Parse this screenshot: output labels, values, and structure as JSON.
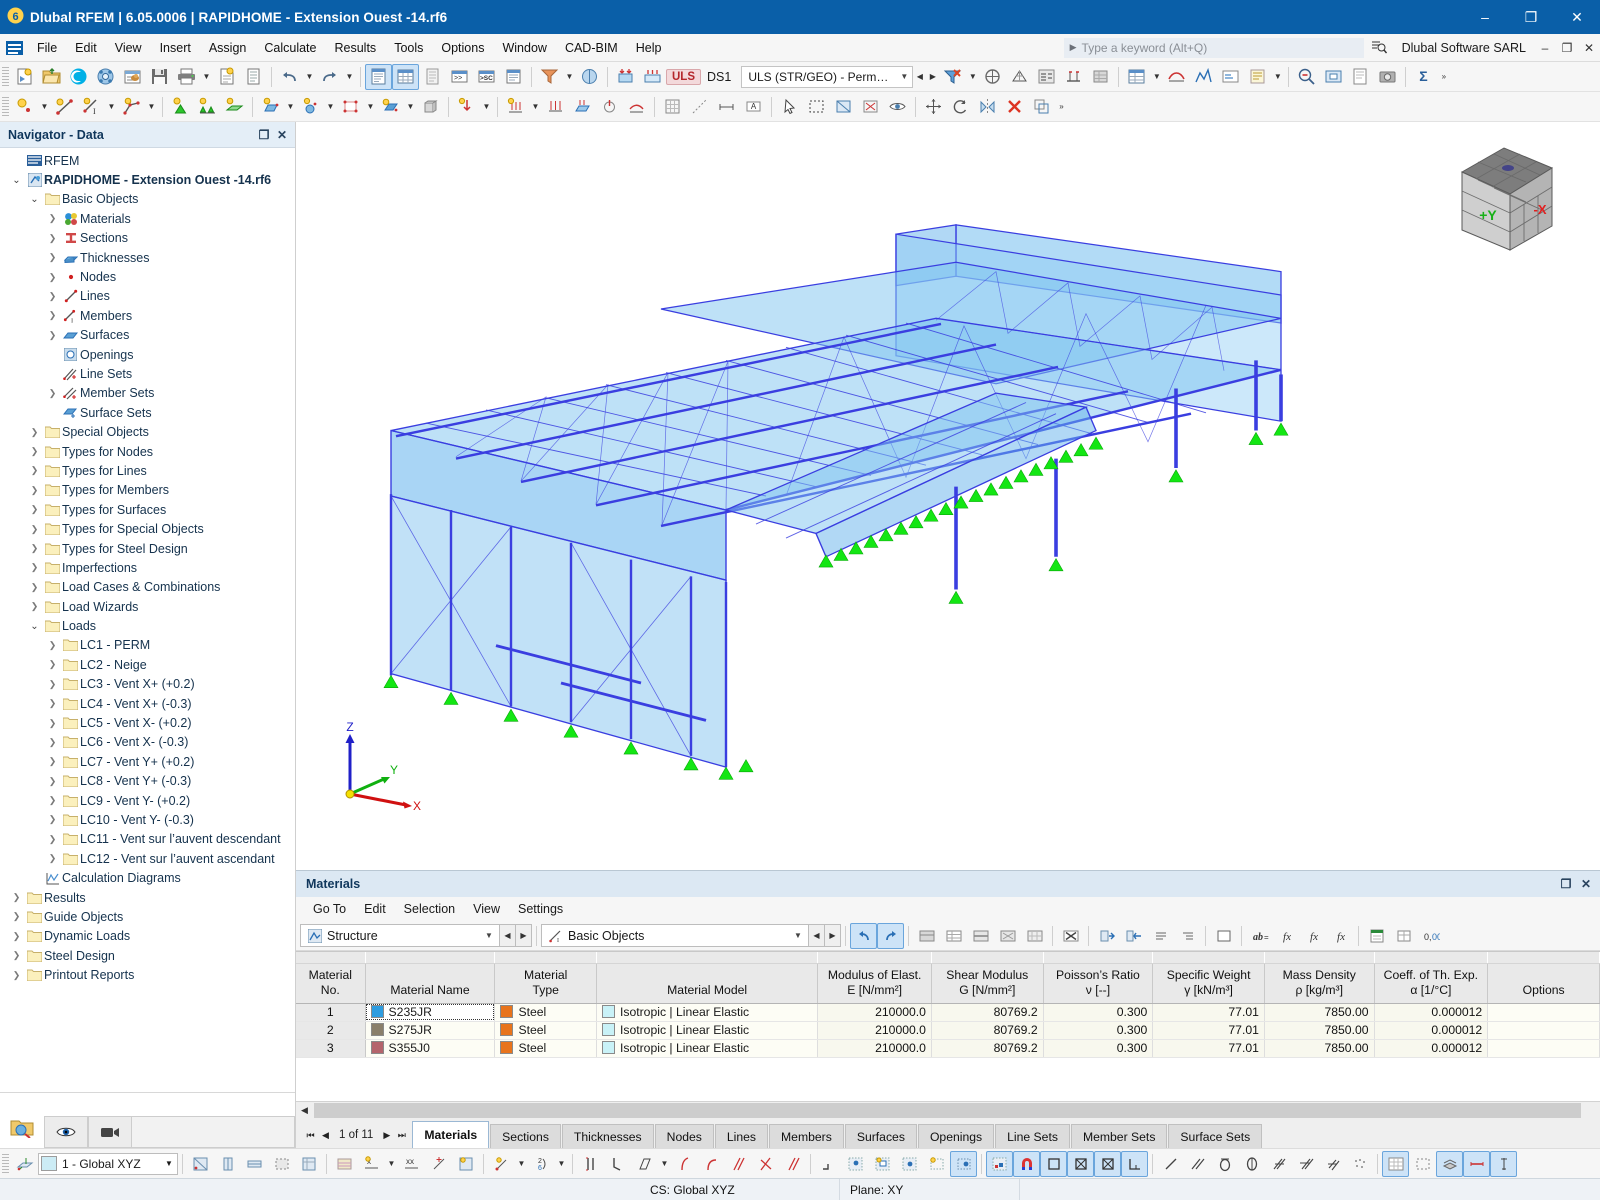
{
  "titlebar": {
    "icon": "dlubal-logo-icon",
    "text": "Dlubal RFEM | 6.05.0006 | RAPIDHOME - Extension Ouest -14.rf6",
    "minimize": "–",
    "maximize": "❐",
    "close": "✕"
  },
  "menubar": {
    "items": [
      "File",
      "Edit",
      "View",
      "Insert",
      "Assign",
      "Calculate",
      "Results",
      "Tools",
      "Options",
      "Window",
      "CAD-BIM",
      "Help"
    ],
    "search_placeholder": "Type a keyword (Alt+Q)",
    "company": "Dlubal Software SARL",
    "win_minimize": "–",
    "win_restore": "❐",
    "win_close": "✕"
  },
  "toolbar": {
    "uls_badge": "ULS",
    "design_situation": "DS1",
    "combination": "ULS (STR/GEO) - Permane...",
    "combination_full": "ULS (STR/GEO) - Permanent / transient"
  },
  "navigator": {
    "title": "Navigator - Data",
    "undock": "❐",
    "close": "✕",
    "tree": [
      {
        "depth": 0,
        "label": "RFEM",
        "icon": "rfem-icon",
        "twisty": "none",
        "bold": false
      },
      {
        "depth": 0,
        "label": "RAPIDHOME - Extension Ouest -14.rf6",
        "icon": "model-icon",
        "twisty": "open",
        "bold": true
      },
      {
        "depth": 1,
        "label": "Basic Objects",
        "icon": "folder-icon",
        "twisty": "open",
        "bold": false
      },
      {
        "depth": 2,
        "label": "Materials",
        "icon": "materials-icon",
        "twisty": "closed",
        "bold": false
      },
      {
        "depth": 2,
        "label": "Sections",
        "icon": "sections-icon",
        "twisty": "closed",
        "bold": false
      },
      {
        "depth": 2,
        "label": "Thicknesses",
        "icon": "thicknesses-icon",
        "twisty": "closed",
        "bold": false
      },
      {
        "depth": 2,
        "label": "Nodes",
        "icon": "node-icon",
        "twisty": "closed",
        "bold": false
      },
      {
        "depth": 2,
        "label": "Lines",
        "icon": "line-icon",
        "twisty": "closed",
        "bold": false
      },
      {
        "depth": 2,
        "label": "Members",
        "icon": "member-icon",
        "twisty": "closed",
        "bold": false
      },
      {
        "depth": 2,
        "label": "Surfaces",
        "icon": "surface-icon",
        "twisty": "closed",
        "bold": false
      },
      {
        "depth": 2,
        "label": "Openings",
        "icon": "opening-icon",
        "twisty": "none",
        "bold": false
      },
      {
        "depth": 2,
        "label": "Line Sets",
        "icon": "line-set-icon",
        "twisty": "none",
        "bold": false
      },
      {
        "depth": 2,
        "label": "Member Sets",
        "icon": "member-set-icon",
        "twisty": "closed",
        "bold": false
      },
      {
        "depth": 2,
        "label": "Surface Sets",
        "icon": "surface-set-icon",
        "twisty": "none",
        "bold": false
      },
      {
        "depth": 1,
        "label": "Special Objects",
        "icon": "folder-icon",
        "twisty": "closed",
        "bold": false
      },
      {
        "depth": 1,
        "label": "Types for Nodes",
        "icon": "folder-icon",
        "twisty": "closed",
        "bold": false
      },
      {
        "depth": 1,
        "label": "Types for Lines",
        "icon": "folder-icon",
        "twisty": "closed",
        "bold": false
      },
      {
        "depth": 1,
        "label": "Types for Members",
        "icon": "folder-icon",
        "twisty": "closed",
        "bold": false
      },
      {
        "depth": 1,
        "label": "Types for Surfaces",
        "icon": "folder-icon",
        "twisty": "closed",
        "bold": false
      },
      {
        "depth": 1,
        "label": "Types for Special Objects",
        "icon": "folder-icon",
        "twisty": "closed",
        "bold": false
      },
      {
        "depth": 1,
        "label": "Types for Steel Design",
        "icon": "folder-icon",
        "twisty": "closed",
        "bold": false
      },
      {
        "depth": 1,
        "label": "Imperfections",
        "icon": "folder-icon",
        "twisty": "closed",
        "bold": false
      },
      {
        "depth": 1,
        "label": "Load Cases & Combinations",
        "icon": "folder-icon",
        "twisty": "closed",
        "bold": false
      },
      {
        "depth": 1,
        "label": "Load Wizards",
        "icon": "folder-icon",
        "twisty": "closed",
        "bold": false
      },
      {
        "depth": 1,
        "label": "Loads",
        "icon": "folder-icon",
        "twisty": "open",
        "bold": false
      },
      {
        "depth": 2,
        "label": "LC1 - PERM",
        "icon": "folder-icon",
        "twisty": "closed",
        "bold": false
      },
      {
        "depth": 2,
        "label": "LC2 - Neige",
        "icon": "folder-icon",
        "twisty": "closed",
        "bold": false
      },
      {
        "depth": 2,
        "label": "LC3 - Vent X+ (+0.2)",
        "icon": "folder-icon",
        "twisty": "closed",
        "bold": false
      },
      {
        "depth": 2,
        "label": "LC4 - Vent X+ (-0.3)",
        "icon": "folder-icon",
        "twisty": "closed",
        "bold": false
      },
      {
        "depth": 2,
        "label": "LC5 - Vent X- (+0.2)",
        "icon": "folder-icon",
        "twisty": "closed",
        "bold": false
      },
      {
        "depth": 2,
        "label": "LC6 - Vent X- (-0.3)",
        "icon": "folder-icon",
        "twisty": "closed",
        "bold": false
      },
      {
        "depth": 2,
        "label": "LC7 - Vent Y+ (+0.2)",
        "icon": "folder-icon",
        "twisty": "closed",
        "bold": false
      },
      {
        "depth": 2,
        "label": "LC8 - Vent Y+ (-0.3)",
        "icon": "folder-icon",
        "twisty": "closed",
        "bold": false
      },
      {
        "depth": 2,
        "label": "LC9 - Vent Y- (+0.2)",
        "icon": "folder-icon",
        "twisty": "closed",
        "bold": false
      },
      {
        "depth": 2,
        "label": "LC10 - Vent Y- (-0.3)",
        "icon": "folder-icon",
        "twisty": "closed",
        "bold": false
      },
      {
        "depth": 2,
        "label": "LC11 - Vent sur l’auvent descendant",
        "icon": "folder-icon",
        "twisty": "closed",
        "bold": false
      },
      {
        "depth": 2,
        "label": "LC12 - Vent sur l’auvent ascendant",
        "icon": "folder-icon",
        "twisty": "closed",
        "bold": false
      },
      {
        "depth": 1,
        "label": "Calculation Diagrams",
        "icon": "diagram-icon",
        "twisty": "none",
        "bold": false
      },
      {
        "depth": 0,
        "label": "Results",
        "icon": "folder-icon",
        "twisty": "closed",
        "bold": false
      },
      {
        "depth": 0,
        "label": "Guide Objects",
        "icon": "folder-icon",
        "twisty": "closed",
        "bold": false
      },
      {
        "depth": 0,
        "label": "Dynamic Loads",
        "icon": "folder-icon",
        "twisty": "closed",
        "bold": false
      },
      {
        "depth": 0,
        "label": "Steel Design",
        "icon": "folder-icon",
        "twisty": "closed",
        "bold": false
      },
      {
        "depth": 0,
        "label": "Printout Reports",
        "icon": "folder-icon",
        "twisty": "closed",
        "bold": false
      }
    ]
  },
  "viewport": {
    "nav_cube": {
      "face_left": "+Y",
      "face_right": "-X"
    },
    "axes": {
      "x": "X",
      "y": "Y",
      "z": "Z"
    }
  },
  "dock": {
    "title": "Materials",
    "undock": "❐",
    "close": "✕",
    "menu": [
      "Go To",
      "Edit",
      "Selection",
      "View",
      "Settings"
    ],
    "combo_left": "Structure",
    "combo_right": "Basic Objects",
    "table": {
      "columns": [
        {
          "line1": "Material",
          "line2": "No."
        },
        {
          "line1": "",
          "line2": "Material Name"
        },
        {
          "line1": "Material",
          "line2": "Type"
        },
        {
          "line1": "",
          "line2": "Material Model"
        },
        {
          "line1": "Modulus of Elast.",
          "line2": "E [N/mm²]"
        },
        {
          "line1": "Shear Modulus",
          "line2": "G [N/mm²]"
        },
        {
          "line1": "Poisson’s Ratio",
          "line2": "ν [--]"
        },
        {
          "line1": "Specific Weight",
          "line2": "γ [kN/m³]"
        },
        {
          "line1": "Mass Density",
          "line2": "ρ [kg/m³]"
        },
        {
          "line1": "Coeff. of Th. Exp.",
          "line2": "α [1/°C]"
        },
        {
          "line1": "",
          "line2": "Options"
        }
      ],
      "rows": [
        {
          "no": "1",
          "name": "S235JR",
          "name_color": "#2d9ce0",
          "type": "Steel",
          "type_color": "#e8741c",
          "model": "Isotropic | Linear Elastic",
          "model_color": "#c9f2f7",
          "E": "210000.0",
          "G": "80769.2",
          "nu": "0.300",
          "gamma": "77.01",
          "rho": "7850.00",
          "alpha": "0.000012",
          "options": ""
        },
        {
          "no": "2",
          "name": "S275JR",
          "name_color": "#8a7f6b",
          "type": "Steel",
          "type_color": "#e8741c",
          "model": "Isotropic | Linear Elastic",
          "model_color": "#c9f2f7",
          "E": "210000.0",
          "G": "80769.2",
          "nu": "0.300",
          "gamma": "77.01",
          "rho": "7850.00",
          "alpha": "0.000012",
          "options": ""
        },
        {
          "no": "3",
          "name": "S355J0",
          "name_color": "#b4646c",
          "type": "Steel",
          "type_color": "#e8741c",
          "model": "Isotropic | Linear Elastic",
          "model_color": "#c9f2f7",
          "E": "210000.0",
          "G": "80769.2",
          "nu": "0.300",
          "gamma": "77.01",
          "rho": "7850.00",
          "alpha": "0.000012",
          "options": ""
        }
      ]
    },
    "pager": {
      "first": "⏮",
      "prev": "◀",
      "text": "1 of 11",
      "next": "▶",
      "last": "⏭"
    },
    "tabs": [
      "Materials",
      "Sections",
      "Thicknesses",
      "Nodes",
      "Lines",
      "Members",
      "Surfaces",
      "Openings",
      "Line Sets",
      "Member Sets",
      "Surface Sets"
    ],
    "active_tab": "Materials"
  },
  "bottom": {
    "cs_combo": "1 - Global XYZ"
  },
  "status": {
    "cs": "CS: Global XYZ",
    "plane": "Plane: XY"
  },
  "colors": {
    "title_blue": "#0a5fa8",
    "accent": "#2d6fb5",
    "model_blue": "#4da6e8",
    "member_blue": "#3a3ee0",
    "support_green": "#13e613",
    "uls_red": "#b4262b"
  }
}
